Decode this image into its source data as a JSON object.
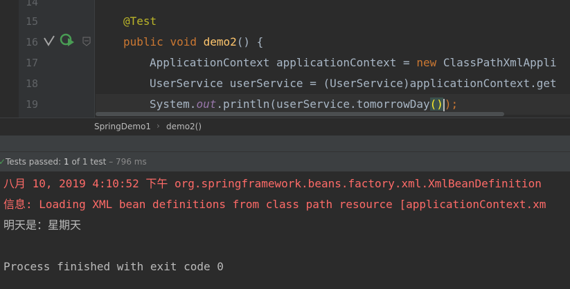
{
  "editor": {
    "line_numbers": [
      "14",
      "15",
      "16",
      "17",
      "18",
      "19"
    ],
    "lines": [
      {
        "text": ""
      },
      {
        "annotation": "@Test"
      },
      {
        "kw1": "public",
        "kw2": "void",
        "method": "demo2",
        "rest": "() {"
      },
      {
        "type": "ApplicationContext applicationContext = ",
        "kw": "new",
        "rest": " ClassPathXmlAppli"
      },
      {
        "text": "UserService userService = (UserService)applicationContext.get"
      },
      {
        "pre": "System.",
        "field": "out",
        "mid": ".println(userService.tomorrowDay",
        "paren": "()",
        "post": ");"
      }
    ]
  },
  "breadcrumb": {
    "items": [
      "SpringDemo1",
      "demo2()"
    ]
  },
  "status": {
    "passed_label": "Tests passed:",
    "count": "1",
    "of_label": "of 1 test",
    "dash": "–",
    "duration": "796 ms"
  },
  "console": {
    "lines": [
      "八月 10, 2019 4:10:52 下午 org.springframework.beans.factory.xml.XmlBeanDefinition",
      "信息: Loading XML bean definitions from class path resource [applicationContext.xm",
      "明天是：星期天",
      "",
      "Process finished with exit code 0"
    ]
  },
  "colors": {
    "background": "#2B2B2B",
    "keyword": "#CC7832",
    "annotation": "#BBB529",
    "method": "#FFC66D",
    "field": "#9876AA",
    "error_text": "#FF6B68",
    "success_icon": "#499C54"
  },
  "icons": [
    "run-test-check-icon",
    "rerun-icon",
    "fold-icon"
  ]
}
